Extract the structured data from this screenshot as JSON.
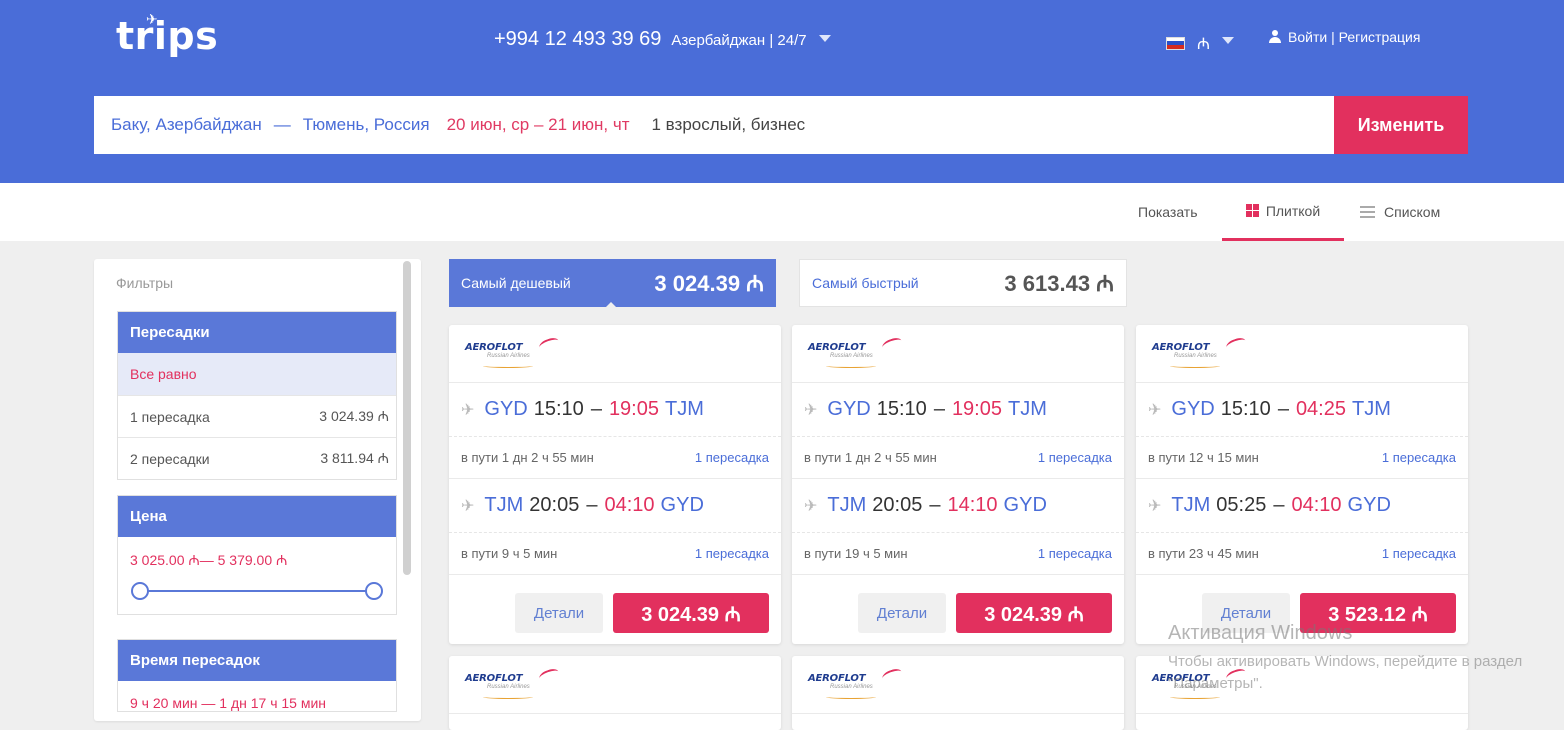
{
  "header": {
    "logo": "trips",
    "phone": "+994 12 493 39 69",
    "region": "Азербайджан | 24/7",
    "currency_symbol": "₼",
    "account_label": "Войти | Регистрация"
  },
  "search": {
    "from": "Баку, Азербайджан",
    "separator": "—",
    "to": "Тюмень, Россия",
    "dates": "20 июн, ср – 21 июн, чт",
    "passengers": "1 взрослый, бизнес",
    "change_label": "Изменить"
  },
  "view": {
    "label": "Показать",
    "tile_label": "Плиткой",
    "list_label": "Списком"
  },
  "filters": {
    "title": "Фильтры",
    "transfers": {
      "heading": "Пересадки",
      "options": [
        {
          "label": "Все равно",
          "value": ""
        },
        {
          "label": "1 пересадка",
          "value": "3 024.39 ₼"
        },
        {
          "label": "2 пересадки",
          "value": "3 811.94 ₼"
        }
      ]
    },
    "price": {
      "heading": "Цена",
      "range": "3 025.00 ₼— 5 379.00 ₼"
    },
    "transfer_time": {
      "heading": "Время пересадок",
      "range": "9 ч 20 мин — 1 дн 17 ч 15 мин"
    }
  },
  "tabs": {
    "cheapest": {
      "label": "Самый дешевый",
      "price": "3 024.39 ₼"
    },
    "fastest": {
      "label": "Самый быстрый",
      "price": "3 613.43 ₼"
    }
  },
  "cards": [
    {
      "airline_logo": "AEROFLOT",
      "airline_sub": "Russian Airlines",
      "out": {
        "from": "GYD",
        "dep": "15:10",
        "arr": "19:05",
        "to": "TJM",
        "duration": "в пути 1 дн 2 ч 55 мин",
        "stops": "1 пересадка"
      },
      "back": {
        "from": "TJM",
        "dep": "20:05",
        "arr": "04:10",
        "to": "GYD",
        "duration": "в пути 9 ч 5 мин",
        "stops": "1 пересадка"
      },
      "details_label": "Детали",
      "price": "3 024.39 ₼"
    },
    {
      "airline_logo": "AEROFLOT",
      "airline_sub": "Russian Airlines",
      "out": {
        "from": "GYD",
        "dep": "15:10",
        "arr": "19:05",
        "to": "TJM",
        "duration": "в пути 1 дн 2 ч 55 мин",
        "stops": "1 пересадка"
      },
      "back": {
        "from": "TJM",
        "dep": "20:05",
        "arr": "14:10",
        "to": "GYD",
        "duration": "в пути 19 ч 5 мин",
        "stops": "1 пересадка"
      },
      "details_label": "Детали",
      "price": "3 024.39 ₼"
    },
    {
      "airline_logo": "AEROFLOT",
      "airline_sub": "Russian Airlines",
      "out": {
        "from": "GYD",
        "dep": "15:10",
        "arr": "04:25",
        "to": "TJM",
        "duration": "в пути 12 ч 15 мин",
        "stops": "1 пересадка"
      },
      "back": {
        "from": "TJM",
        "dep": "05:25",
        "arr": "04:10",
        "to": "GYD",
        "duration": "в пути 23 ч 45 мин",
        "stops": "1 пересадка"
      },
      "details_label": "Детали",
      "price": "3 523.12 ₼"
    }
  ],
  "next_cards": [
    {
      "airline_logo": "AEROFLOT",
      "airline_sub": "Russian Airlines"
    },
    {
      "airline_logo": "AEROFLOT",
      "airline_sub": "Russian Airlines"
    },
    {
      "airline_logo": "AEROFLOT",
      "airline_sub": "Russian Airlines"
    }
  ],
  "watermark": {
    "title": "Активация Windows",
    "text": "Чтобы активировать Windows, перейдите в раздел \"Параметры\"."
  },
  "colors": {
    "brand": "#4a6dd8",
    "accent": "#e2305e"
  }
}
